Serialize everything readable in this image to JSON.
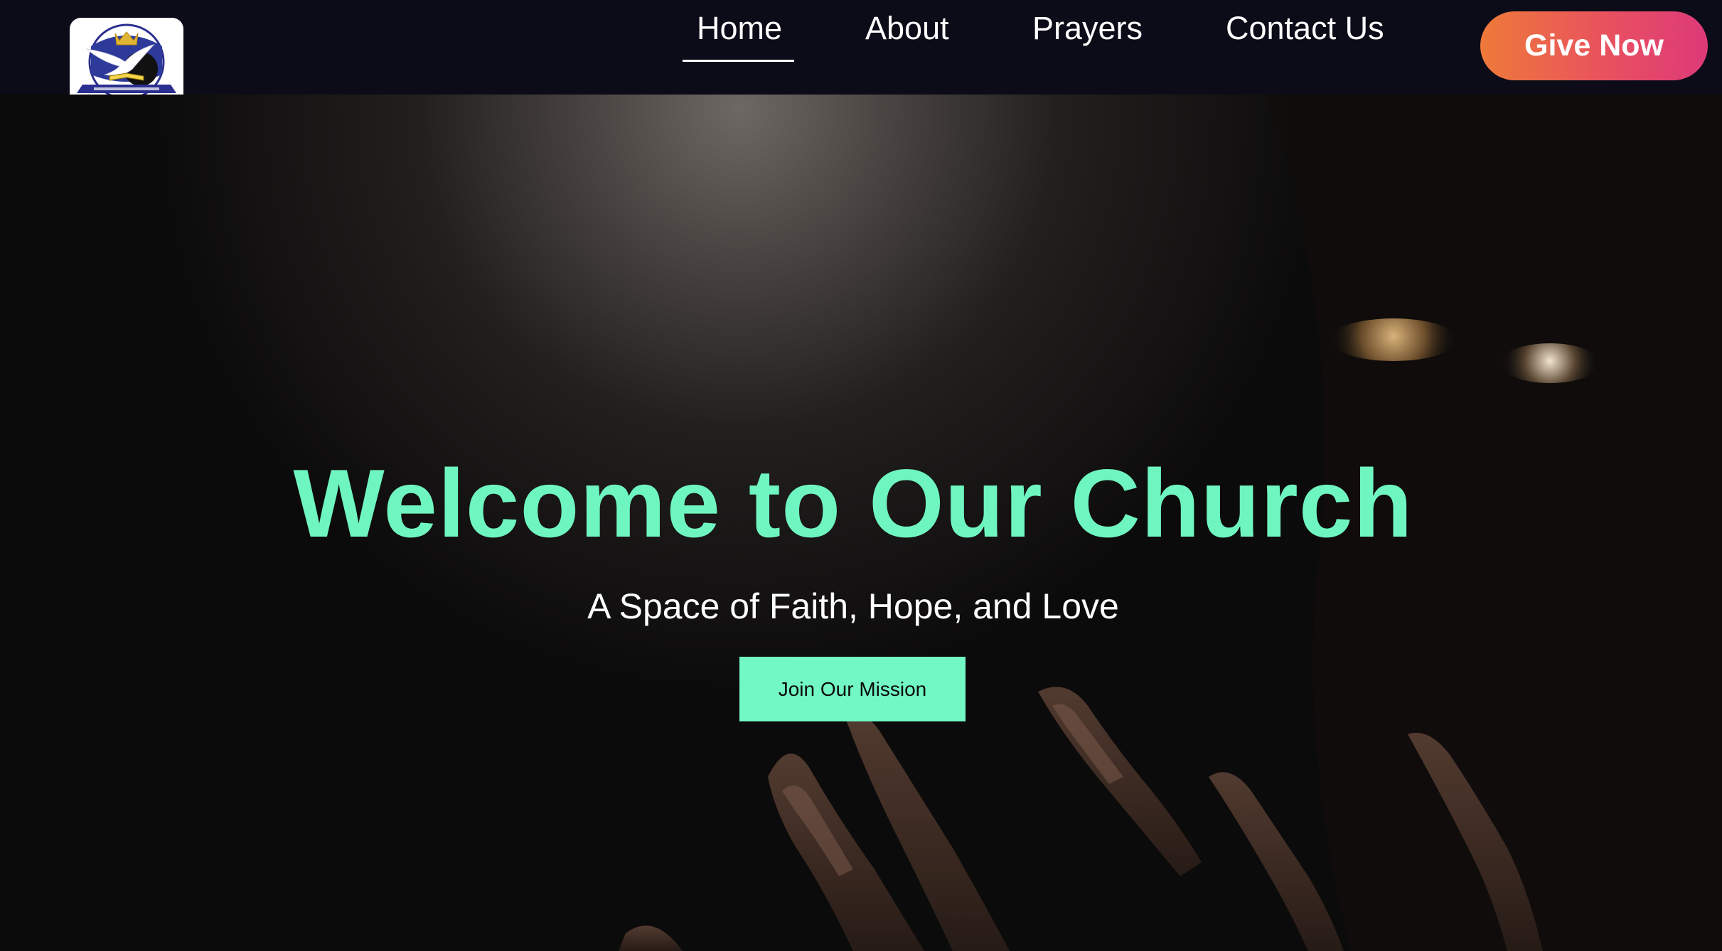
{
  "header": {
    "logo_alt": "church-logo",
    "nav": [
      {
        "label": "Home",
        "active": true
      },
      {
        "label": "About"
      },
      {
        "label": "Prayers"
      },
      {
        "label": "Contact Us"
      }
    ],
    "give_label": "Give Now"
  },
  "hero": {
    "title": "Welcome to Our Church",
    "subtitle": "A Space of Faith, Hope, and Love",
    "cta_label": "Join Our Mission"
  },
  "colors": {
    "header_bg": "#0b0c18",
    "accent": "#6ff6c0",
    "give_gradient_start": "#ee7a39",
    "give_gradient_end": "#dc3a78",
    "hero_bg": "#0c0b0b"
  }
}
